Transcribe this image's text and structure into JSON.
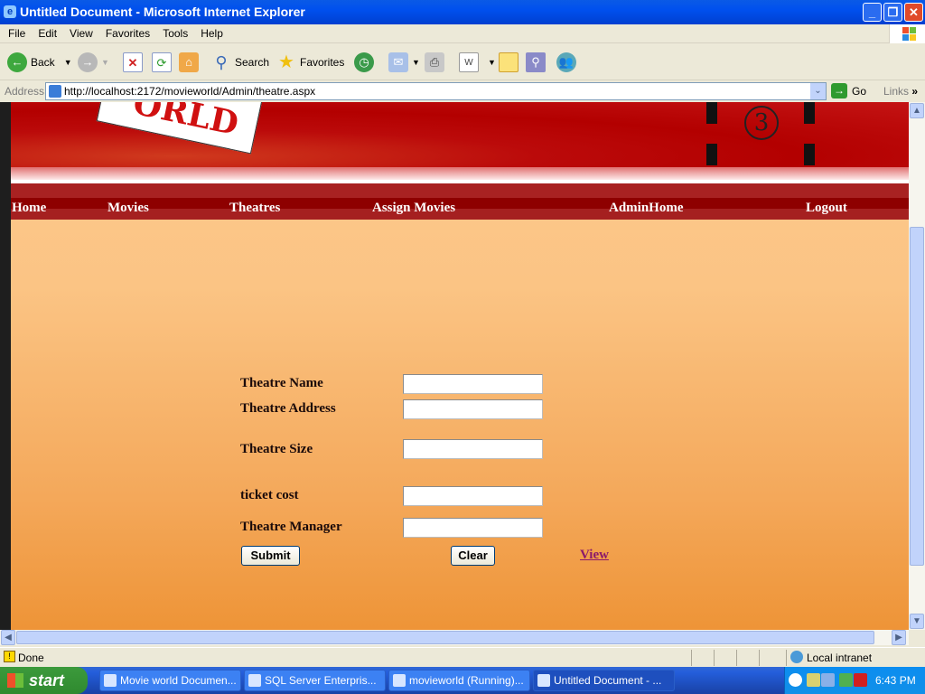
{
  "window": {
    "title": "Untitled Document - Microsoft Internet Explorer",
    "controls": {
      "minimize": "_",
      "restore": "❐",
      "close": "✕"
    }
  },
  "menu": [
    "File",
    "Edit",
    "View",
    "Favorites",
    "Tools",
    "Help"
  ],
  "toolbar": {
    "back_label": "Back",
    "search_label": "Search",
    "favorites_label": "Favorites"
  },
  "address": {
    "label": "Address",
    "url": "http://localhost:2172/movieworld/Admin/theatre.aspx",
    "go_label": "Go",
    "links_label": "Links"
  },
  "banner": {
    "sign_text": "ORLD",
    "film_number": "3"
  },
  "nav": {
    "items": [
      "Home",
      "Movies",
      "Theatres",
      "Assign Movies",
      "AdminHome",
      "Logout"
    ]
  },
  "form": {
    "fields": [
      {
        "label": "Theatre Name",
        "value": ""
      },
      {
        "label": "Theatre Address",
        "value": ""
      },
      {
        "label": "Theatre Size",
        "value": ""
      },
      {
        "label": "ticket cost",
        "value": ""
      },
      {
        "label": "Theatre Manager",
        "value": ""
      }
    ],
    "submit_label": "Submit",
    "clear_label": "Clear",
    "view_label": "View"
  },
  "status": {
    "text": "Done",
    "zone": "Local intranet"
  },
  "taskbar": {
    "start_label": "start",
    "tasks": [
      "Movie world Documen...",
      "SQL Server Enterpris...",
      "movieworld (Running)...",
      "Untitled Document - ..."
    ],
    "clock": "6:43 PM"
  },
  "colors": {
    "nav_bg": "#8e0000",
    "banner_red": "#b30000",
    "page_top": "#fdc98e",
    "page_bottom": "#ee9437",
    "link_visited": "#8b1a6b"
  }
}
